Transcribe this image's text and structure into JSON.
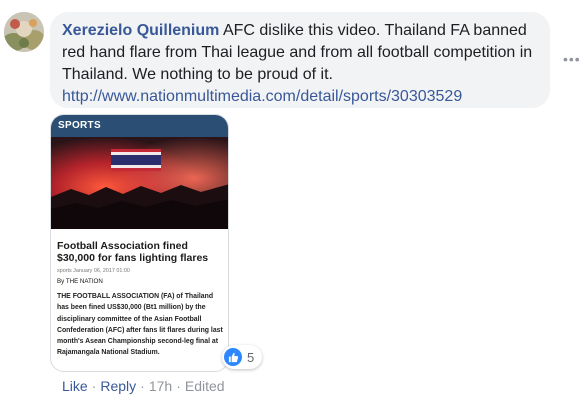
{
  "comment": {
    "author": "Xerezielo Quillenium",
    "text": "AFC dislike this video. Thailand FA banned red hand flare from Thai league and from all football competition in Thailand. We nothing to be proud of it.",
    "link": "http://www.nationmultimedia.com/detail/sports/30303529"
  },
  "article": {
    "section": "SPORTS",
    "headline": "Football Association fined $30,000 for fans lighting flares",
    "meta": "sports   January 06, 2017 01:00",
    "byline": "By THE NATION",
    "body": "THE FOOTBALL ASSOCIATION (FA) of Thailand has been fined US$30,000 (Bt1 million) by the disciplinary committee of the Asian Football Confederation (AFC) after fans lit flares during last month's Asean Championship second-leg final at Rajamangala National Stadium."
  },
  "reactions": {
    "icon": "like-icon",
    "count": "5"
  },
  "actions": {
    "like": "Like",
    "reply": "Reply",
    "time": "17h",
    "edited": "Edited",
    "separator": "·"
  },
  "colors": {
    "link": "#385898",
    "bubble": "#f2f3f5",
    "section_bar": "#2b4f74",
    "like_badge": "#2d88ff",
    "muted": "#90949c"
  }
}
